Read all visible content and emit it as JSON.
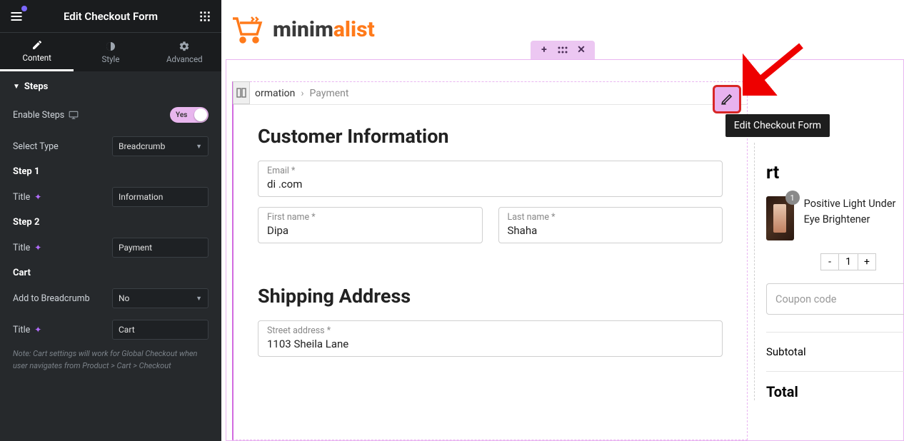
{
  "sidebar": {
    "header_title": "Edit Checkout Form",
    "tabs": {
      "content": "Content",
      "style": "Style",
      "advanced": "Advanced"
    },
    "section_title": "Steps",
    "enable_steps_label": "Enable Steps",
    "enable_steps_value": "Yes",
    "select_type": {
      "label": "Select Type",
      "value": "Breadcrumb"
    },
    "step1": {
      "head": "Step 1",
      "title_label": "Title",
      "title_value": "Information"
    },
    "step2": {
      "head": "Step 2",
      "title_label": "Title",
      "title_value": "Payment"
    },
    "cart": {
      "head": "Cart",
      "add_label": "Add to Breadcrumb",
      "add_value": "No",
      "title_label": "Title",
      "title_value": "Cart",
      "note": "Note: Cart settings will work for Global Checkout when user navigates from Product > Cart > Checkout"
    }
  },
  "brand": {
    "part1": "minim",
    "part2": "alist"
  },
  "breadcrumb": {
    "step1": "ormation",
    "step2": "Payment"
  },
  "forms": {
    "customer_heading": "Customer Information",
    "email": {
      "label": "Email *",
      "value": "di                    .com"
    },
    "first": {
      "label": "First name *",
      "value": "Dipa"
    },
    "last": {
      "label": "Last name *",
      "value": "Shaha"
    },
    "shipping_heading": "Shipping Address",
    "street": {
      "label": "Street address *",
      "value": "1103 Sheila Lane"
    }
  },
  "cart_panel": {
    "title": "rt",
    "badge": "1",
    "item_name": "Positive Light Under Eye Brightener",
    "qty": "1",
    "coupon_placeholder": "Coupon code",
    "subtotal_label": "Subtotal",
    "total_label": "Total"
  },
  "tooltip": "Edit Checkout Form"
}
